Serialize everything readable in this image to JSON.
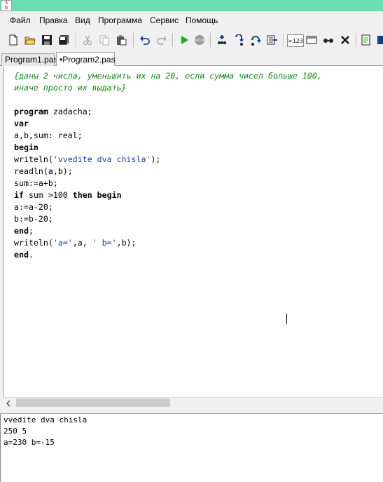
{
  "window": {
    "icon_text": "A\nB\nC"
  },
  "menu": [
    "Файл",
    "Правка",
    "Вид",
    "Программа",
    "Сервис",
    "Помощь"
  ],
  "toolbar": {
    "icons": [
      "new-file-icon",
      "open-icon",
      "save-icon",
      "save-all-icon",
      "cut-icon",
      "copy-icon",
      "paste-icon",
      "undo-icon",
      "redo-icon",
      "run-icon",
      "stop-icon",
      "add-watch-icon",
      "step-into-icon",
      "step-over-icon",
      "run-to-cursor-icon",
      "eval-icon",
      "window-icon",
      "glasses-icon",
      "close-icon",
      "compile-icon",
      "debug-icon"
    ],
    "eval_label": ">123"
  },
  "tabs": [
    {
      "label": "Program1.pas",
      "active": false
    },
    {
      "label": "•Program2.pas",
      "active": true
    }
  ],
  "editor": {
    "lines": [
      {
        "text": "{даны 2 числа, уменьшить их на 20, если сумма чисел больше 100,",
        "type": "comment"
      },
      {
        "text": "иначе просто их выдать}",
        "type": "comment"
      },
      {
        "text": "",
        "type": "plain"
      },
      {
        "text": "program zadacha;",
        "type": "code"
      },
      {
        "text": "var",
        "type": "code"
      },
      {
        "text": "a,b,sum: real;",
        "type": "code"
      },
      {
        "text": "begin",
        "type": "code"
      },
      {
        "text": "writeln('vvedite dva chisla');",
        "type": "code"
      },
      {
        "text": "readln(a,b);",
        "type": "code"
      },
      {
        "text": "sum:=a+b;",
        "type": "code"
      },
      {
        "text": "if sum >100 then begin",
        "type": "code"
      },
      {
        "text": "a:=a-20;",
        "type": "code"
      },
      {
        "text": "b:=b-20;",
        "type": "code"
      },
      {
        "text": "end;",
        "type": "code"
      },
      {
        "text": "writeln('a=',a, ' b=',b);",
        "type": "code"
      },
      {
        "text": "end.",
        "type": "code"
      }
    ]
  },
  "output": {
    "lines": [
      "vvedite dva chisla",
      "250 5",
      "a=230 b=-15"
    ]
  },
  "colors": {
    "titlebar": "#6edcb4",
    "comment": "#148a14",
    "string": "#1a3fa8"
  }
}
